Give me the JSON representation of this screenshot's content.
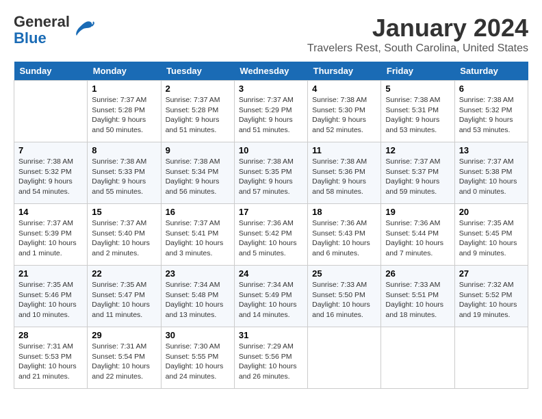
{
  "logo": {
    "line1": "General",
    "line2": "Blue"
  },
  "title": "January 2024",
  "subtitle": "Travelers Rest, South Carolina, United States",
  "days_header": [
    "Sunday",
    "Monday",
    "Tuesday",
    "Wednesday",
    "Thursday",
    "Friday",
    "Saturday"
  ],
  "weeks": [
    [
      {
        "day": "",
        "sunrise": "",
        "sunset": "",
        "daylight": ""
      },
      {
        "day": "1",
        "sunrise": "Sunrise: 7:37 AM",
        "sunset": "Sunset: 5:28 PM",
        "daylight": "Daylight: 9 hours and 50 minutes."
      },
      {
        "day": "2",
        "sunrise": "Sunrise: 7:37 AM",
        "sunset": "Sunset: 5:28 PM",
        "daylight": "Daylight: 9 hours and 51 minutes."
      },
      {
        "day": "3",
        "sunrise": "Sunrise: 7:37 AM",
        "sunset": "Sunset: 5:29 PM",
        "daylight": "Daylight: 9 hours and 51 minutes."
      },
      {
        "day": "4",
        "sunrise": "Sunrise: 7:38 AM",
        "sunset": "Sunset: 5:30 PM",
        "daylight": "Daylight: 9 hours and 52 minutes."
      },
      {
        "day": "5",
        "sunrise": "Sunrise: 7:38 AM",
        "sunset": "Sunset: 5:31 PM",
        "daylight": "Daylight: 9 hours and 53 minutes."
      },
      {
        "day": "6",
        "sunrise": "Sunrise: 7:38 AM",
        "sunset": "Sunset: 5:32 PM",
        "daylight": "Daylight: 9 hours and 53 minutes."
      }
    ],
    [
      {
        "day": "7",
        "sunrise": "Sunrise: 7:38 AM",
        "sunset": "Sunset: 5:32 PM",
        "daylight": "Daylight: 9 hours and 54 minutes."
      },
      {
        "day": "8",
        "sunrise": "Sunrise: 7:38 AM",
        "sunset": "Sunset: 5:33 PM",
        "daylight": "Daylight: 9 hours and 55 minutes."
      },
      {
        "day": "9",
        "sunrise": "Sunrise: 7:38 AM",
        "sunset": "Sunset: 5:34 PM",
        "daylight": "Daylight: 9 hours and 56 minutes."
      },
      {
        "day": "10",
        "sunrise": "Sunrise: 7:38 AM",
        "sunset": "Sunset: 5:35 PM",
        "daylight": "Daylight: 9 hours and 57 minutes."
      },
      {
        "day": "11",
        "sunrise": "Sunrise: 7:38 AM",
        "sunset": "Sunset: 5:36 PM",
        "daylight": "Daylight: 9 hours and 58 minutes."
      },
      {
        "day": "12",
        "sunrise": "Sunrise: 7:37 AM",
        "sunset": "Sunset: 5:37 PM",
        "daylight": "Daylight: 9 hours and 59 minutes."
      },
      {
        "day": "13",
        "sunrise": "Sunrise: 7:37 AM",
        "sunset": "Sunset: 5:38 PM",
        "daylight": "Daylight: 10 hours and 0 minutes."
      }
    ],
    [
      {
        "day": "14",
        "sunrise": "Sunrise: 7:37 AM",
        "sunset": "Sunset: 5:39 PM",
        "daylight": "Daylight: 10 hours and 1 minute."
      },
      {
        "day": "15",
        "sunrise": "Sunrise: 7:37 AM",
        "sunset": "Sunset: 5:40 PM",
        "daylight": "Daylight: 10 hours and 2 minutes."
      },
      {
        "day": "16",
        "sunrise": "Sunrise: 7:37 AM",
        "sunset": "Sunset: 5:41 PM",
        "daylight": "Daylight: 10 hours and 3 minutes."
      },
      {
        "day": "17",
        "sunrise": "Sunrise: 7:36 AM",
        "sunset": "Sunset: 5:42 PM",
        "daylight": "Daylight: 10 hours and 5 minutes."
      },
      {
        "day": "18",
        "sunrise": "Sunrise: 7:36 AM",
        "sunset": "Sunset: 5:43 PM",
        "daylight": "Daylight: 10 hours and 6 minutes."
      },
      {
        "day": "19",
        "sunrise": "Sunrise: 7:36 AM",
        "sunset": "Sunset: 5:44 PM",
        "daylight": "Daylight: 10 hours and 7 minutes."
      },
      {
        "day": "20",
        "sunrise": "Sunrise: 7:35 AM",
        "sunset": "Sunset: 5:45 PM",
        "daylight": "Daylight: 10 hours and 9 minutes."
      }
    ],
    [
      {
        "day": "21",
        "sunrise": "Sunrise: 7:35 AM",
        "sunset": "Sunset: 5:46 PM",
        "daylight": "Daylight: 10 hours and 10 minutes."
      },
      {
        "day": "22",
        "sunrise": "Sunrise: 7:35 AM",
        "sunset": "Sunset: 5:47 PM",
        "daylight": "Daylight: 10 hours and 11 minutes."
      },
      {
        "day": "23",
        "sunrise": "Sunrise: 7:34 AM",
        "sunset": "Sunset: 5:48 PM",
        "daylight": "Daylight: 10 hours and 13 minutes."
      },
      {
        "day": "24",
        "sunrise": "Sunrise: 7:34 AM",
        "sunset": "Sunset: 5:49 PM",
        "daylight": "Daylight: 10 hours and 14 minutes."
      },
      {
        "day": "25",
        "sunrise": "Sunrise: 7:33 AM",
        "sunset": "Sunset: 5:50 PM",
        "daylight": "Daylight: 10 hours and 16 minutes."
      },
      {
        "day": "26",
        "sunrise": "Sunrise: 7:33 AM",
        "sunset": "Sunset: 5:51 PM",
        "daylight": "Daylight: 10 hours and 18 minutes."
      },
      {
        "day": "27",
        "sunrise": "Sunrise: 7:32 AM",
        "sunset": "Sunset: 5:52 PM",
        "daylight": "Daylight: 10 hours and 19 minutes."
      }
    ],
    [
      {
        "day": "28",
        "sunrise": "Sunrise: 7:31 AM",
        "sunset": "Sunset: 5:53 PM",
        "daylight": "Daylight: 10 hours and 21 minutes."
      },
      {
        "day": "29",
        "sunrise": "Sunrise: 7:31 AM",
        "sunset": "Sunset: 5:54 PM",
        "daylight": "Daylight: 10 hours and 22 minutes."
      },
      {
        "day": "30",
        "sunrise": "Sunrise: 7:30 AM",
        "sunset": "Sunset: 5:55 PM",
        "daylight": "Daylight: 10 hours and 24 minutes."
      },
      {
        "day": "31",
        "sunrise": "Sunrise: 7:29 AM",
        "sunset": "Sunset: 5:56 PM",
        "daylight": "Daylight: 10 hours and 26 minutes."
      },
      {
        "day": "",
        "sunrise": "",
        "sunset": "",
        "daylight": ""
      },
      {
        "day": "",
        "sunrise": "",
        "sunset": "",
        "daylight": ""
      },
      {
        "day": "",
        "sunrise": "",
        "sunset": "",
        "daylight": ""
      }
    ]
  ]
}
